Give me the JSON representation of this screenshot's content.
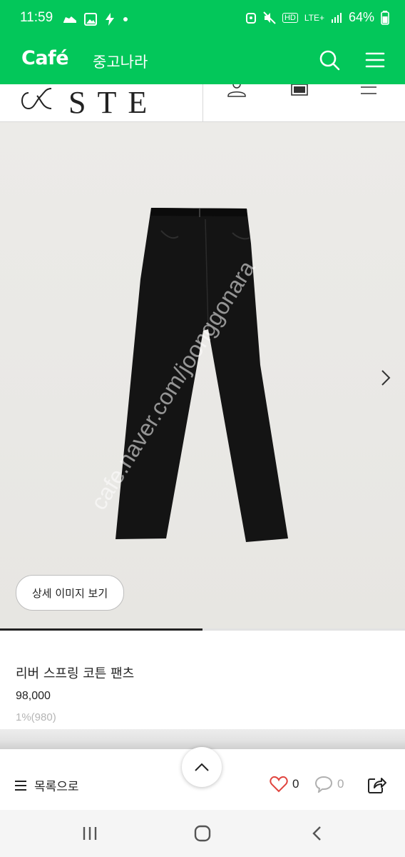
{
  "status_bar": {
    "time": "11:59",
    "battery": "64%",
    "network": "LTE+",
    "hd": "HD"
  },
  "cafe_bar": {
    "logo": "Café",
    "name": "중고나라"
  },
  "shop": {
    "brand": "STE"
  },
  "product": {
    "watermark": "cafe.naver.com/joonggonara",
    "detail_button": "상세 이미지 보기",
    "name": "리버 스프링 코튼 팬츠",
    "price": "98,000",
    "point": "1%(980)",
    "gallery_progress": 0.5
  },
  "bottom_bar": {
    "list_label": "목록으로",
    "like_count": "0",
    "comment_count": "0"
  },
  "colors": {
    "naver_green": "#03c75a",
    "like_red": "#e0443e"
  },
  "icons": [
    "search-icon",
    "menu-icon",
    "user-icon",
    "bag-icon",
    "hamburger-icon",
    "chevron-right-icon",
    "chevron-up-icon",
    "list-icon",
    "heart-icon",
    "comment-icon",
    "share-icon",
    "recent-apps-icon",
    "home-icon",
    "back-icon"
  ]
}
